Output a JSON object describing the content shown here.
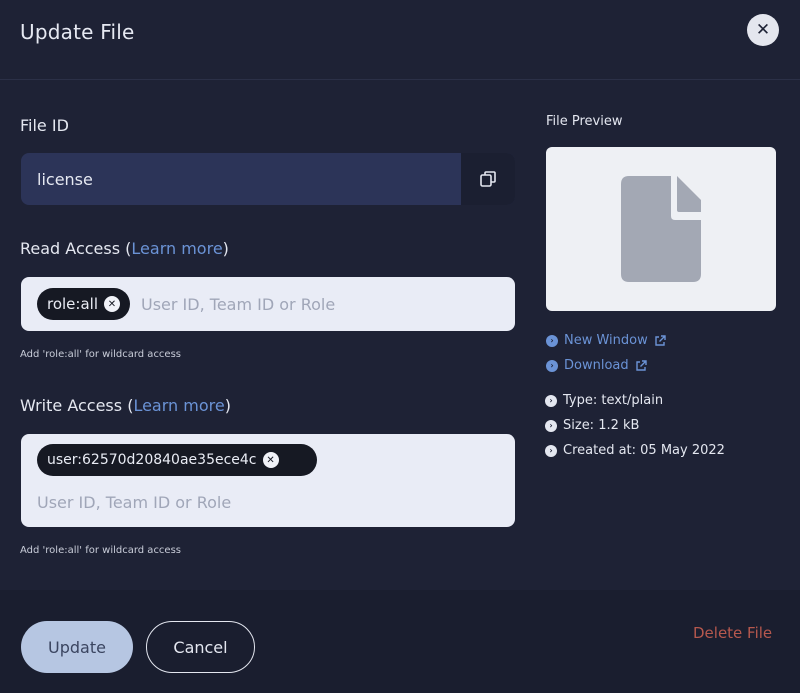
{
  "modal": {
    "title": "Update File",
    "close_icon": "close-icon"
  },
  "file_id": {
    "label": "File ID",
    "value": "license",
    "copy_icon": "copy-icon"
  },
  "read_access": {
    "label": "Read Access",
    "open_paren": "(",
    "learn_more": "Learn more",
    "close_paren": ")",
    "tags": [
      "role:all"
    ],
    "placeholder": "User ID, Team ID or Role",
    "hint": "Add 'role:all' for wildcard access"
  },
  "write_access": {
    "label": "Write Access",
    "open_paren": "(",
    "learn_more": "Learn more",
    "close_paren": ")",
    "tags": [
      "user:62570d20840ae35ece4c"
    ],
    "placeholder": "User ID, Team ID or Role",
    "hint": "Add 'role:all' for wildcard access"
  },
  "preview": {
    "label": "File Preview",
    "file_icon": "file-icon",
    "links": [
      "New Window",
      "Download"
    ],
    "info": [
      "Type: text/plain",
      "Size: 1.2 kB",
      "Created at: 05 May 2022"
    ]
  },
  "footer": {
    "update": "Update",
    "cancel": "Cancel",
    "delete": "Delete File"
  },
  "colors": {
    "link": "#6b93d6",
    "danger": "#b6584e",
    "bg": "#1e2235"
  }
}
